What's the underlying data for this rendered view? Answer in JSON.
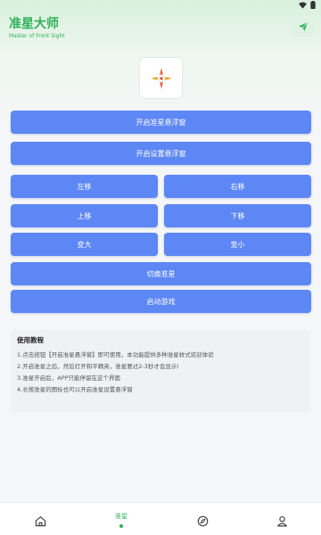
{
  "app": {
    "title": "准星大师",
    "subtitle": "Master of Front Sight"
  },
  "buttons": {
    "open_floating": "开启准星悬浮窗",
    "open_settings_floating": "开启设置悬浮窗",
    "move_left": "左移",
    "move_right": "右移",
    "move_up": "上移",
    "move_down": "下移",
    "bigger": "变大",
    "smaller": "变小",
    "switch_crosshair": "切换准星",
    "start_game": "启动游戏"
  },
  "tutorial": {
    "title": "使用教程",
    "lines": [
      "1.点击按钮【开启准星悬浮窗】即可使用，本功能提供多种准星样式欢迎体验",
      "2.开启准星之后，然后打开和平精英，准星要过2-3秒才会显示!",
      "3.准星开启后，APP只能停留在这个界面",
      "4.长按准星的图标也可以开启准星设置悬浮窗"
    ]
  },
  "nav": {
    "active_label": "准星"
  },
  "colors": {
    "accent_green": "#2fb15a",
    "button_blue": "#5d87f5"
  }
}
